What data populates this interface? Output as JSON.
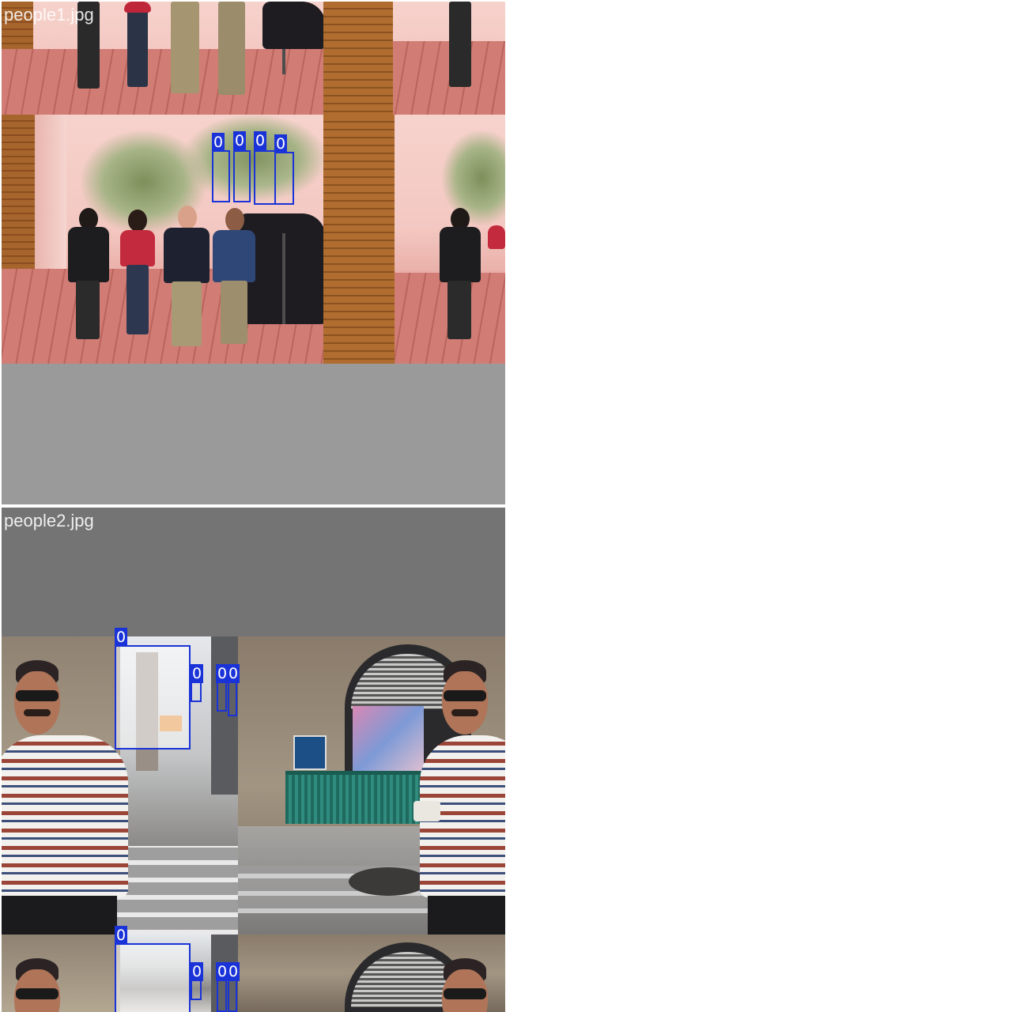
{
  "tiles": [
    {
      "filename": "people1.jpg",
      "detections": [
        {
          "class_id": "0"
        },
        {
          "class_id": "0"
        },
        {
          "class_id": "0"
        },
        {
          "class_id": "0"
        }
      ]
    },
    {
      "filename": "people2.jpg",
      "detections_upper": [
        {
          "class_id": "0"
        },
        {
          "class_id": "0"
        },
        {
          "class_id": "0"
        },
        {
          "class_id": "0"
        }
      ],
      "detections_lower": [
        {
          "class_id": "0"
        },
        {
          "class_id": "0"
        },
        {
          "class_id": "0"
        },
        {
          "class_id": "0"
        }
      ]
    }
  ],
  "colors": {
    "box": "#1a33d8",
    "label_text": "#ffffff",
    "padding_gray_top": "#9a9a9a",
    "padding_gray_bottom": "#747474"
  }
}
